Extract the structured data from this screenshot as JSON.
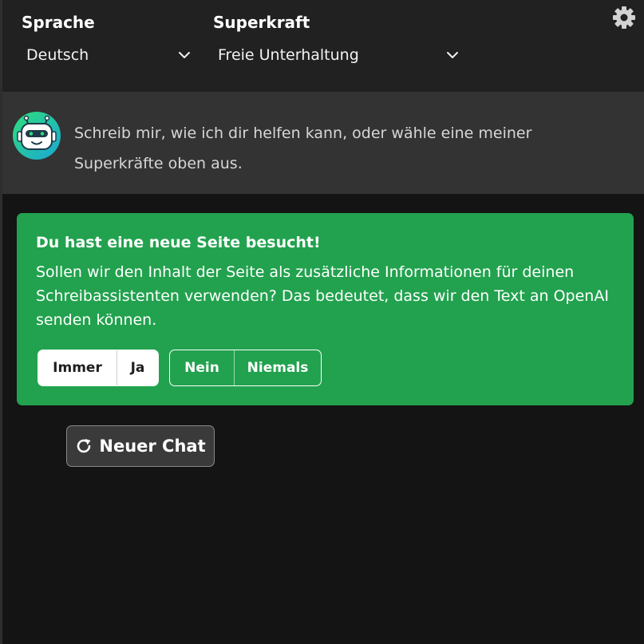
{
  "header": {
    "language_label": "Sprache",
    "language_value": "Deutsch",
    "superpower_label": "Superkraft",
    "superpower_value": "Freie Unterhaltung"
  },
  "intro": {
    "message": "Schreib mir, wie ich dir helfen kann, oder wähle eine meiner Superkräfte oben aus."
  },
  "consent": {
    "title": "Du hast eine neue Seite besucht!",
    "text": "Sollen wir den Inhalt der Seite als zusätzliche Informationen für deinen Schreibassistenten verwenden? Das bedeutet, dass wir den Text an OpenAI senden können.",
    "buttons": {
      "always": "Immer",
      "yes": "Ja",
      "no": "Nein",
      "never": "Niemals"
    }
  },
  "new_chat": {
    "label": "Neuer Chat"
  },
  "icons": {
    "settings": "gear-icon",
    "dropdown": "chevron-down-icon",
    "avatar": "robot-icon",
    "refresh": "refresh-icon"
  },
  "colors": {
    "background": "#141414",
    "header": "#212121",
    "intro": "#333333",
    "accent_green": "#22a24e"
  }
}
